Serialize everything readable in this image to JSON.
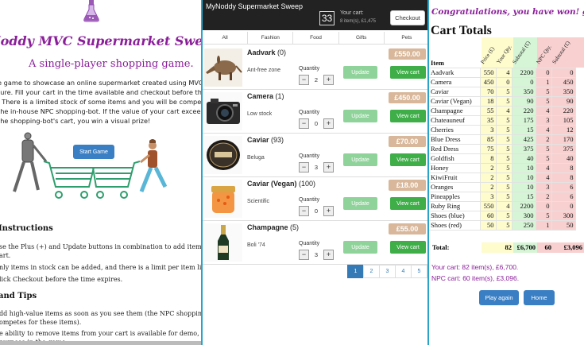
{
  "intro_panel": {
    "title": "Noddy MVC Supermarket Sweep",
    "subtitle": "A single-player shopping game.",
    "intro_lines": [
      "e game to showcase an online supermarket created using MVC",
      "ture. Fill your cart in the time available and checkout before the time",
      ". There is a limited stock of some items and you will be competing",
      " the in-house NPC shopping-bot. If the value of your cart exceeds the",
      " the shopping-bot's cart, you win a visual prize!"
    ],
    "start_button": "Start Game",
    "instructions_heading": "Instructions",
    "instructions": [
      "se the Plus (+) and Update buttons in combination to add items to your",
      "art.",
      "nly items in stock can be added, and there is a limit per item line.",
      "lick Checkout before the time expires."
    ],
    "tips_heading": "and Tips",
    "tips": [
      "dd high-value items as soon as you see them (the NPC shopping-bot",
      "ompetes for these items).",
      "e ability to remove items from your cart is available for demo, but has",
      "purpose in the game"
    ]
  },
  "shop_panel": {
    "brand": "MyNoddy Supermarket Sweep",
    "timer": "33",
    "cart_label": "Your cart:",
    "cart_summary": "8 item(s), £1,475",
    "checkout_label": "Checkout",
    "tabs": [
      "All",
      "Fashion",
      "Food",
      "Gifts",
      "Pets"
    ],
    "quantity_label": "Quantity",
    "update_label": "Update",
    "view_cart_label": "View cart",
    "products": [
      {
        "name": "Aadvark",
        "stock": "(0)",
        "desc": "Ant-free zone",
        "price": "£550.00",
        "qty": "2",
        "image": "aardvark"
      },
      {
        "name": "Camera",
        "stock": "(1)",
        "desc": "Low stock",
        "price": "£450.00",
        "qty": "0",
        "image": "camera"
      },
      {
        "name": "Caviar",
        "stock": "(93)",
        "desc": "Beluga",
        "price": "£70.00",
        "qty": "3",
        "image": "caviar-tin"
      },
      {
        "name": "Caviar (Vegan)",
        "stock": "(100)",
        "desc": "Scientific",
        "price": "£18.00",
        "qty": "0",
        "image": "caviar-jar"
      },
      {
        "name": "Champagne",
        "stock": "(5)",
        "desc": "Boli '74",
        "price": "£55.00",
        "qty": "3",
        "image": "champagne"
      }
    ],
    "pages": [
      "1",
      "2",
      "3",
      "4",
      "5"
    ],
    "active_page": "1"
  },
  "result_panel": {
    "congrats": "Congratulations, you have won! gg",
    "heading": "Cart Totals",
    "item_header": "Item",
    "columns": [
      "Price (£)",
      "Your Qty.",
      "Subtotal (£)",
      "NPC Qty.",
      "Subtotal (£)"
    ],
    "rows": [
      [
        "Aadvark",
        "550",
        "4",
        "2200",
        "0",
        "0"
      ],
      [
        "Camera",
        "450",
        "0",
        "0",
        "1",
        "450"
      ],
      [
        "Caviar",
        "70",
        "5",
        "350",
        "5",
        "350"
      ],
      [
        "Caviar (Vegan)",
        "18",
        "5",
        "90",
        "5",
        "90"
      ],
      [
        "Champagne",
        "55",
        "4",
        "220",
        "4",
        "220"
      ],
      [
        "Chateauneuf",
        "35",
        "5",
        "175",
        "3",
        "105"
      ],
      [
        "Cherries",
        "3",
        "5",
        "15",
        "4",
        "12"
      ],
      [
        "Blue Dress",
        "85",
        "5",
        "425",
        "2",
        "170"
      ],
      [
        "Red Dress",
        "75",
        "5",
        "375",
        "5",
        "375"
      ],
      [
        "Goldfish",
        "8",
        "5",
        "40",
        "5",
        "40"
      ],
      [
        "Honey",
        "2",
        "5",
        "10",
        "4",
        "8"
      ],
      [
        "KiwiFruit",
        "2",
        "5",
        "10",
        "4",
        "8"
      ],
      [
        "Oranges",
        "2",
        "5",
        "10",
        "3",
        "6"
      ],
      [
        "Pineapples",
        "3",
        "5",
        "15",
        "2",
        "6"
      ],
      [
        "Ruby Ring",
        "550",
        "4",
        "2200",
        "0",
        "0"
      ],
      [
        "Shoes (blue)",
        "60",
        "5",
        "300",
        "5",
        "300"
      ],
      [
        "Shoes (red)",
        "50",
        "5",
        "250",
        "1",
        "50"
      ]
    ],
    "total_label": "Total:",
    "total_your_qty": "82",
    "total_your_sub": "£6,700",
    "total_npc_qty": "60",
    "total_npc_sub": "£3,096",
    "your_cart_text": "Your cart: 82 item(s), £6,700.",
    "npc_cart_text": "NPC cart: 60 item(s), £3,096.",
    "play_again_label": "Play again",
    "home_label": "Home"
  }
}
